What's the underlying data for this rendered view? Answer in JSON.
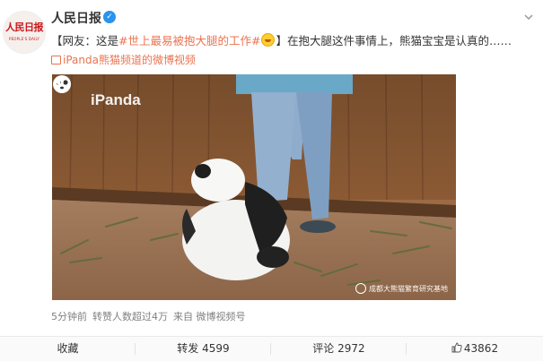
{
  "account": {
    "avatar_logo_text": "人民日报",
    "avatar_logo_subtext": "PEOPLE'S DAILY",
    "name": "人民日报",
    "verified_mark": "✓"
  },
  "post": {
    "prefix": "【网友：这是",
    "hashtag": "#世上最易被抱大腿的工作#",
    "suffix": "】在抱大腿这件事情上，熊猫宝宝是认真的……",
    "video_source": "iPanda熊猫频道的微博视频"
  },
  "video": {
    "watermark_brand": "iPanda",
    "watermark_credit": "成都大熊猫繁育研究基地"
  },
  "meta": {
    "time": "5分钟前",
    "views": "转赞人数超过4万",
    "source": "来自 微博视频号"
  },
  "actions": {
    "favorite": "收藏",
    "repost_label": "转发",
    "repost_count": "4599",
    "comment_label": "评论",
    "comment_count": "2972",
    "like_count": "43862"
  },
  "colors": {
    "link": "#eb7350",
    "verified": "#2a93ef",
    "brand_red": "#c8161d"
  },
  "icons": [
    "verified-icon",
    "more-chevron-icon",
    "emoji-icon",
    "video-icon",
    "ipanda-logo-icon",
    "volume-icon",
    "like-thumb-icon"
  ]
}
